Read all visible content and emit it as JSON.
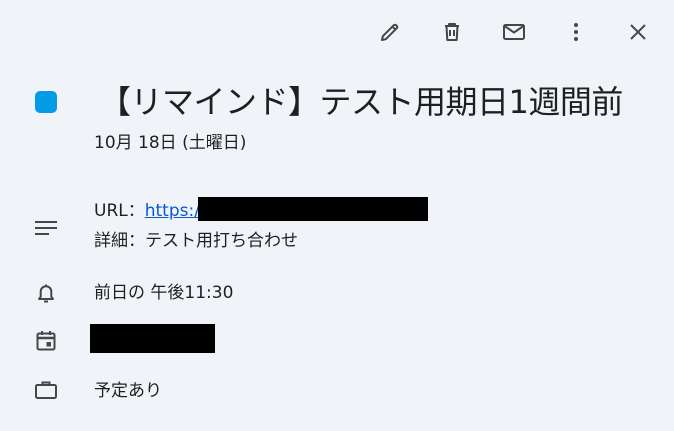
{
  "toolbar": {
    "edit_icon": "pencil-icon",
    "delete_icon": "trash-icon",
    "email_icon": "mail-icon",
    "more_icon": "more-vert-icon",
    "close_icon": "close-icon"
  },
  "event": {
    "color": "#039be5",
    "title": "【リマインド】テスト用期日1週間前",
    "date": "10月 18日 (土曜日)",
    "description": {
      "url_prefix": "URL：",
      "url_link_text": "https:/",
      "detail": "詳細：テスト用打ち合わせ"
    },
    "reminder": "前日の 午後11:30",
    "availability": "予定あり"
  },
  "colors": {
    "background": "#f0f4f9",
    "link": "#0b57d0",
    "text": "#1f1f1f"
  }
}
